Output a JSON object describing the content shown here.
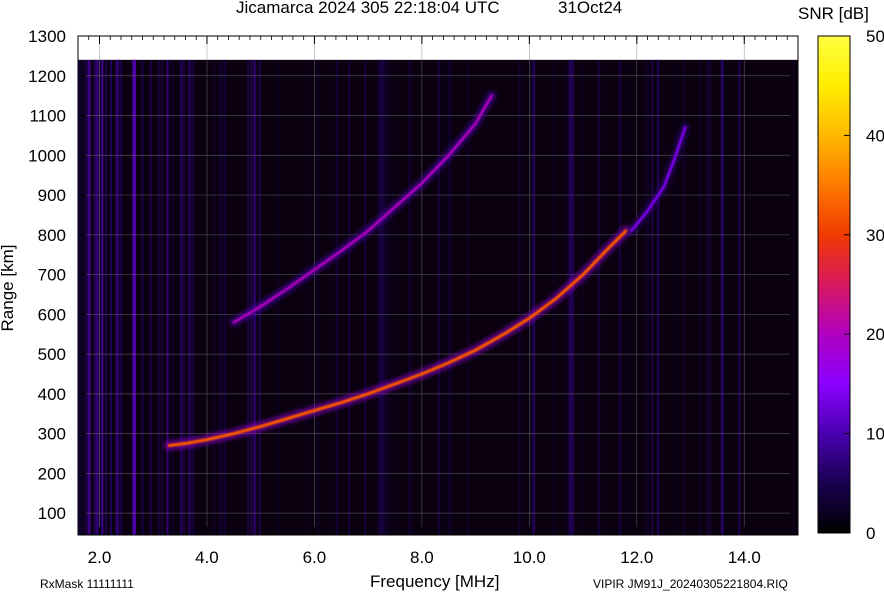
{
  "header": {
    "title": "Jicamarca 2024 305 22:18:04 UTC",
    "date": "31Oct24"
  },
  "colorbar": {
    "label": "SNR [dB]",
    "ticks": [
      "0",
      "10",
      "20",
      "30",
      "40",
      "50"
    ],
    "range": [
      0,
      50
    ],
    "colormap": [
      "#000000",
      "#1a0050",
      "#4a00b0",
      "#8a00ff",
      "#b000c0",
      "#d81860",
      "#f03a00",
      "#ff7a00",
      "#ffb800",
      "#ffee00",
      "#ffff40"
    ]
  },
  "footer": {
    "rxmask": "RxMask 11111111",
    "filename": "VIPIR  JM91J_20240305221804.RIQ"
  },
  "chart_data": {
    "type": "heatmap",
    "title": "Jicamarca 2024 305 22:18:04 UTC",
    "xlabel": "Frequency [MHz]",
    "ylabel": "Range [km]",
    "xlim": [
      1.6,
      15.0
    ],
    "ylim": [
      45,
      1300
    ],
    "xticks": [
      "2.0",
      "4.0",
      "6.0",
      "8.0",
      "10.0",
      "12.0",
      "14.0"
    ],
    "xtick_values": [
      2.0,
      4.0,
      6.0,
      8.0,
      10.0,
      12.0,
      14.0
    ],
    "yticks": [
      "100",
      "200",
      "300",
      "400",
      "500",
      "600",
      "700",
      "800",
      "900",
      "1000",
      "1100",
      "1200",
      "1300"
    ],
    "ytick_values": [
      100,
      200,
      300,
      400,
      500,
      600,
      700,
      800,
      900,
      1000,
      1100,
      1200,
      1300
    ],
    "data_top_range_km": 1240,
    "grid": true,
    "series": [
      {
        "name": "",
        "snr_db": 32,
        "points": [
          [
            3.3,
            270
          ],
          [
            3.6,
            275
          ],
          [
            4.0,
            285
          ],
          [
            4.5,
            300
          ],
          [
            5.0,
            318
          ],
          [
            5.5,
            338
          ],
          [
            6.0,
            358
          ],
          [
            6.5,
            378
          ],
          [
            7.0,
            400
          ],
          [
            7.5,
            425
          ],
          [
            8.0,
            450
          ],
          [
            8.5,
            478
          ],
          [
            9.0,
            510
          ],
          [
            9.5,
            548
          ],
          [
            10.0,
            590
          ],
          [
            10.5,
            640
          ],
          [
            11.0,
            700
          ],
          [
            11.5,
            770
          ],
          [
            11.8,
            810
          ]
        ]
      },
      {
        "name": "",
        "snr_db": 20,
        "points": [
          [
            4.5,
            580
          ],
          [
            5.0,
            620
          ],
          [
            5.5,
            665
          ],
          [
            6.0,
            712
          ],
          [
            6.5,
            760
          ],
          [
            7.0,
            810
          ],
          [
            7.5,
            870
          ],
          [
            8.0,
            930
          ],
          [
            8.5,
            1000
          ],
          [
            9.0,
            1080
          ],
          [
            9.3,
            1150
          ]
        ]
      },
      {
        "name": "",
        "snr_db": 14,
        "points": [
          [
            11.9,
            810
          ],
          [
            12.2,
            860
          ],
          [
            12.5,
            920
          ],
          [
            12.7,
            990
          ],
          [
            12.9,
            1070
          ]
        ]
      },
      {
        "name": "",
        "snr_db": 12,
        "points": [
          [
            1.8,
            100
          ],
          [
            4.0,
            100
          ],
          [
            6.0,
            100
          ],
          [
            8.0,
            100
          ],
          [
            10.0,
            100
          ],
          [
            12.0,
            100
          ]
        ]
      }
    ]
  }
}
